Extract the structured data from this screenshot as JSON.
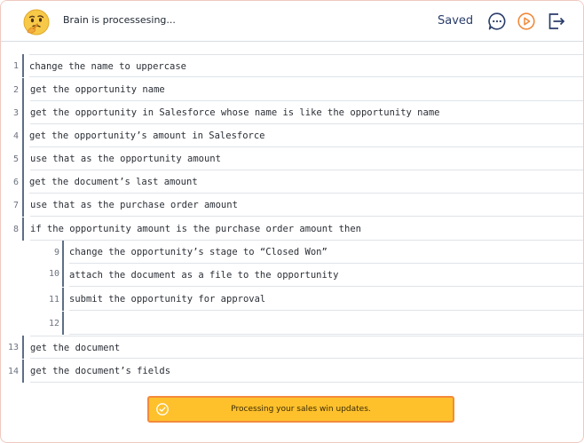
{
  "header": {
    "status": "Brain is processesing...",
    "saved_label": "Saved",
    "icons": [
      "thinking-face-icon",
      "chat-bubble-icon",
      "play-icon",
      "exit-icon"
    ],
    "accent": "#2a3d6a",
    "play_color": "#f08a3a"
  },
  "lines": [
    {
      "num": "1",
      "text": "change the name to uppercase"
    },
    {
      "num": "2",
      "text": "get the opportunity name"
    },
    {
      "num": "3",
      "text": "get the opportunity in Salesforce whose name is like the opportunity name"
    },
    {
      "num": "4",
      "text": "get the opportunity’s amount in Salesforce"
    },
    {
      "num": "5",
      "text": "use that as the opportunity amount"
    },
    {
      "num": "6",
      "text": "get the document’s last amount"
    },
    {
      "num": "7",
      "text": "use that as the purchase order amount"
    },
    {
      "num": "8",
      "text": "if the opportunity amount is the purchase order amount then"
    },
    {
      "num": "9",
      "text": "change the opportunity’s stage to “Closed Won”"
    },
    {
      "num": "10",
      "text": "attach the document as a file to the opportunity"
    },
    {
      "num": "11",
      "text": "submit the opportunity for approval"
    },
    {
      "num": "12",
      "text": ""
    },
    {
      "num": "13",
      "text": "get the document"
    },
    {
      "num": "14",
      "text": "get the document’s fields"
    }
  ],
  "toast": {
    "message": "Processing your sales win updates.",
    "background": "#fec12c",
    "border": "#f38a3a"
  }
}
